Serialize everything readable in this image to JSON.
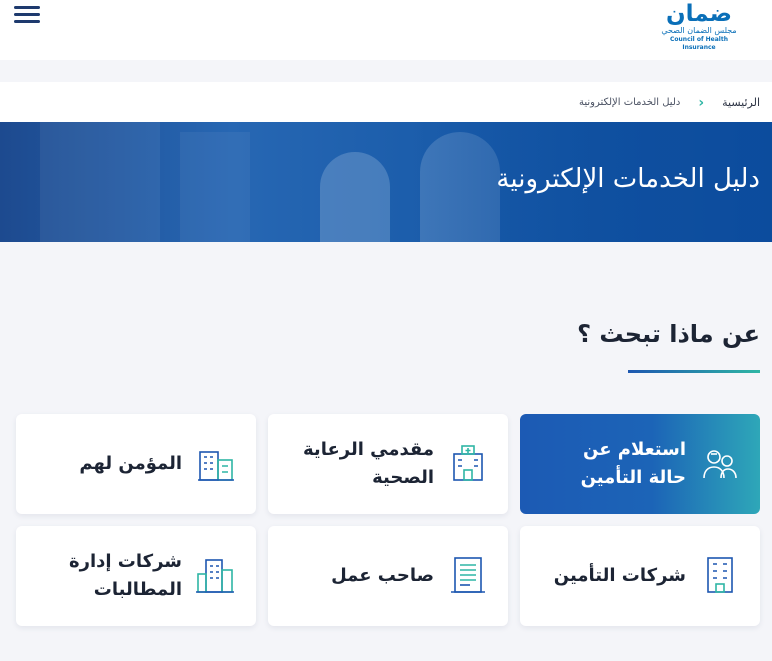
{
  "header": {
    "logo_word": "ضمان",
    "logo_ar": "مجلس الضمان الصحي",
    "logo_en": "Council of Health Insurance",
    "menu_icon": "hamburger-menu-icon"
  },
  "breadcrumb": {
    "home": "الرئيسية",
    "current": "دليل الخدمات الإلكترونية"
  },
  "banner": {
    "title": "دليل الخدمات الإلكترونية"
  },
  "section": {
    "title": "عن ماذا تبحث ؟"
  },
  "cards": [
    {
      "label": "استعلام عن\nحالة التأمين",
      "icon": "people-icon",
      "active": true
    },
    {
      "label": "مقدمي الرعاية\nالصحية",
      "icon": "hospital-icon",
      "active": false
    },
    {
      "label": "المؤمن لهم",
      "icon": "city-buildings-icon",
      "active": false
    },
    {
      "label": "شركات التأمين",
      "icon": "office-building-icon",
      "active": false
    },
    {
      "label": "صاحب عمل",
      "icon": "document-icon",
      "active": false
    },
    {
      "label": "شركات إدارة\nالمطالبات",
      "icon": "company-buildings-icon",
      "active": false
    }
  ],
  "colors": {
    "brand_blue": "#1c5ab4",
    "accent_teal": "#2fb6a5",
    "page_bg": "#f4f5f9"
  }
}
